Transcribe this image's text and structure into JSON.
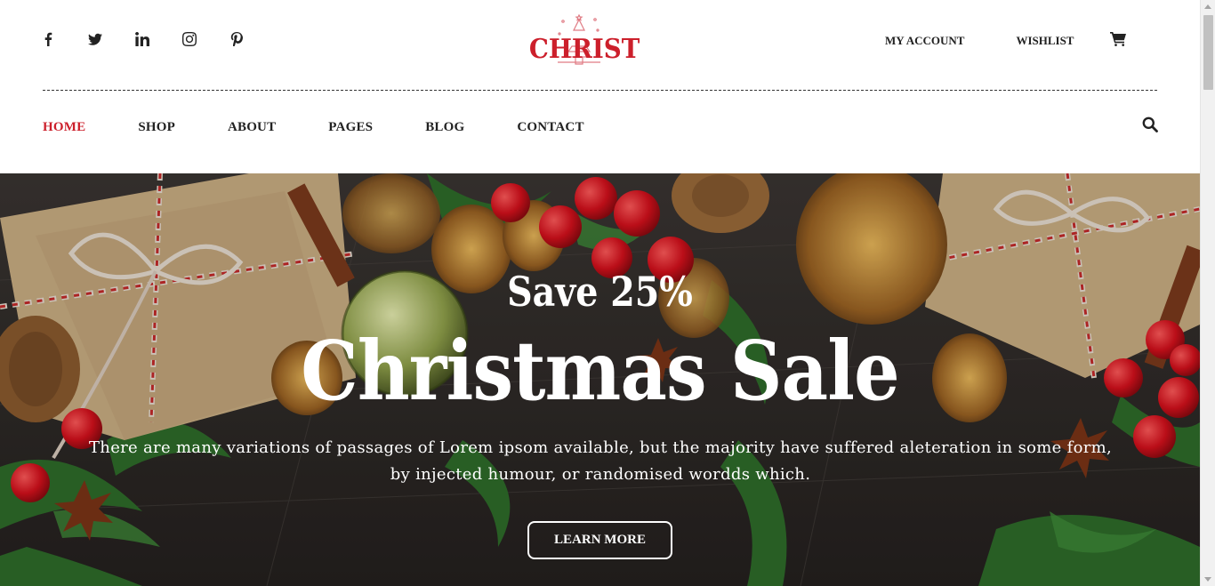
{
  "header": {
    "social": [
      {
        "name": "facebook-icon"
      },
      {
        "name": "twitter-icon"
      },
      {
        "name": "linkedin-icon"
      },
      {
        "name": "instagram-icon"
      },
      {
        "name": "pinterest-icon"
      }
    ],
    "logo_text": "CHRIST",
    "links": {
      "account": "MY ACCOUNT",
      "wishlist": "WISHLIST"
    },
    "cart_icon": "cart-icon"
  },
  "nav": {
    "items": [
      "HOME",
      "SHOP",
      "ABOUT",
      "PAGES",
      "BLOG",
      "CONTACT"
    ],
    "active": "HOME",
    "search_icon": "search-icon"
  },
  "hero": {
    "subtitle": "Save 25%",
    "title": "Christmas Sale",
    "description": "There are many variations of passages of Lorem ipsom available, but the majority have suffered aleteration in some form, by injected humour, or randomised wordds which.",
    "cta_label": "LEARN MORE"
  },
  "colors": {
    "accent": "#cc1f2b",
    "text": "#222222",
    "hero_bg": "#2e2a28"
  }
}
